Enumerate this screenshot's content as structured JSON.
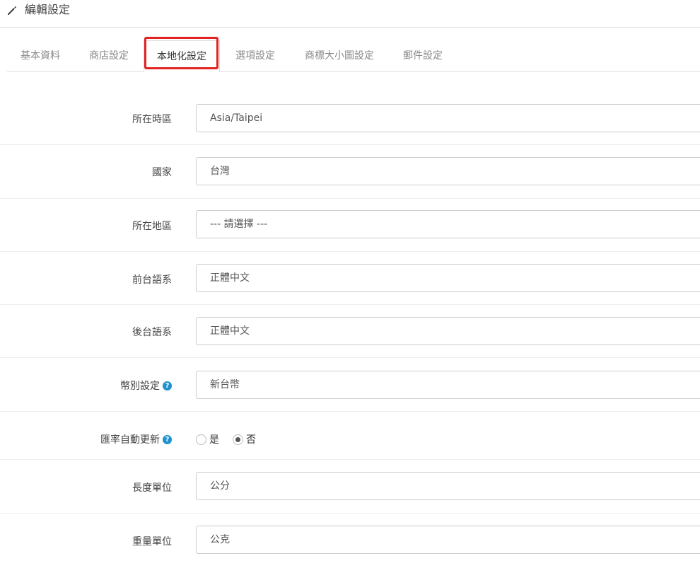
{
  "header": {
    "title": "編輯設定",
    "icon": "pencil-icon"
  },
  "tabs": [
    {
      "label": "基本資料",
      "active": false
    },
    {
      "label": "商店設定",
      "active": false
    },
    {
      "label": "本地化設定",
      "active": true
    },
    {
      "label": "選項設定",
      "active": false
    },
    {
      "label": "商標大小圖設定",
      "active": false
    },
    {
      "label": "郵件設定",
      "active": false
    }
  ],
  "form": {
    "timezone": {
      "label": "所在時區",
      "value": "Asia/Taipei"
    },
    "country": {
      "label": "國家",
      "value": "台灣"
    },
    "zone": {
      "label": "所在地區",
      "value": "--- 請選擇 ---"
    },
    "frontend_language": {
      "label": "前台語系",
      "value": "正體中文"
    },
    "admin_language": {
      "label": "後台語系",
      "value": "正體中文"
    },
    "currency": {
      "label": "幣別設定",
      "value": "新台幣",
      "help": "?"
    },
    "currency_auto_update": {
      "label": "匯率自動更新",
      "help": "?",
      "options": [
        {
          "label": "是",
          "checked": false
        },
        {
          "label": "否",
          "checked": true
        }
      ]
    },
    "length_unit": {
      "label": "長度單位",
      "value": "公分"
    },
    "weight_unit": {
      "label": "重量單位",
      "value": "公克"
    }
  },
  "colors": {
    "highlight": "#e32222",
    "help_badge": "#1e91cf"
  }
}
